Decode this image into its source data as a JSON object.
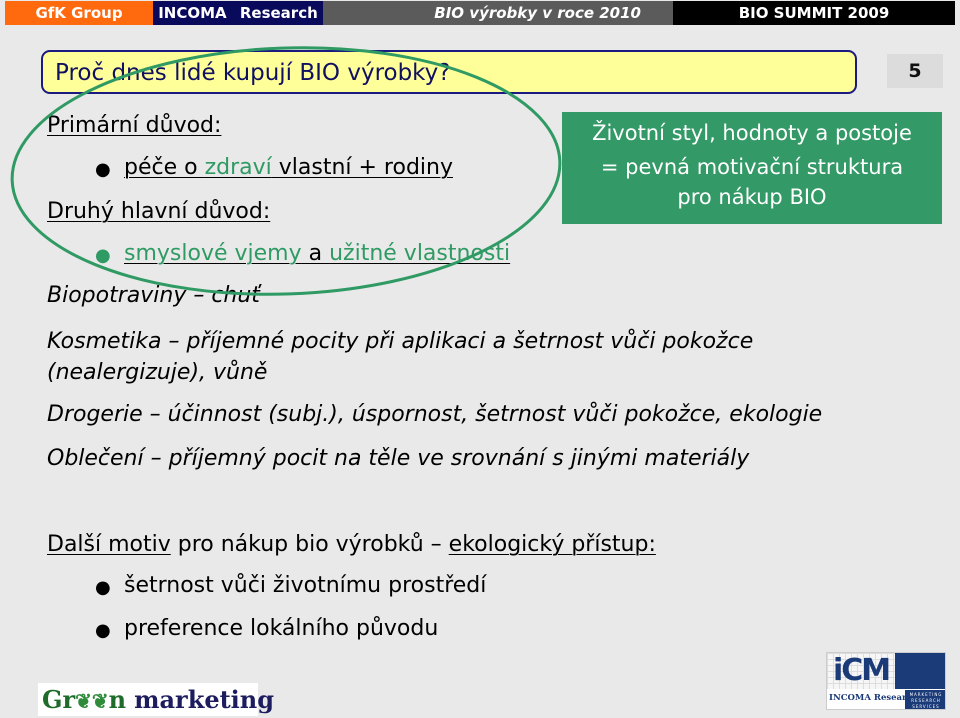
{
  "header": {
    "company": "GfK Group",
    "agency": "INCOMA Research",
    "presentation_title": "BIO výrobky v roce 2010",
    "event": "BIO SUMMIT 2009"
  },
  "slide": {
    "question": "Proč dnes lidé kupují BIO výrobky?",
    "page_number": "5",
    "primary_reason": {
      "heading": "Primární důvod:",
      "bullet_parts": [
        "péče o ",
        "zdraví",
        " vlastní + rodiny"
      ]
    },
    "secondary_reason": {
      "heading": "Druhý hlavní důvod:",
      "bullet_parts": [
        "smyslové vjemy",
        " a ",
        "užitné vlastnosti"
      ]
    },
    "callout": {
      "line1": "Životní styl, hodnoty a postoje",
      "line2": "= pevná motivační struktura",
      "line3": "pro nákup BIO"
    },
    "categories": [
      {
        "text": "Biopotraviny – chuť"
      },
      {
        "text": "Kosmetika – příjemné pocity při aplikaci a šetrnost vůči pokožce",
        "text2": "(nealergizuje), vůně"
      },
      {
        "text": "Drogerie – účinnost (subj.), úspornost, šetrnost vůči pokožce, ekologie"
      },
      {
        "text": "Oblečení – příjemný pocit na těle ve srovnání s jinými materiály"
      }
    ],
    "eco": {
      "heading_part1": "Další motiv",
      "heading_part2": " pro nákup bio výrobků – ",
      "heading_part3": "ekologický přístup:",
      "bullets": [
        "šetrnost vůči životnímu prostředí",
        "preference lokálního původu"
      ]
    }
  },
  "footer": {
    "green_logo": {
      "part1": "Gr",
      "leaves": "❦❦",
      "part2": "n",
      "part3": "marketing"
    },
    "icm_logo": {
      "letters": "iCM",
      "name": "INCOMA Research",
      "services": "MARKETING RESEARCH SERVICES"
    }
  },
  "colors": {
    "orange": "#ff6a0e",
    "navy": "#0a0a5c",
    "green": "#339966",
    "yellow": "#ffff99",
    "ellipse": "#2f9a63"
  }
}
